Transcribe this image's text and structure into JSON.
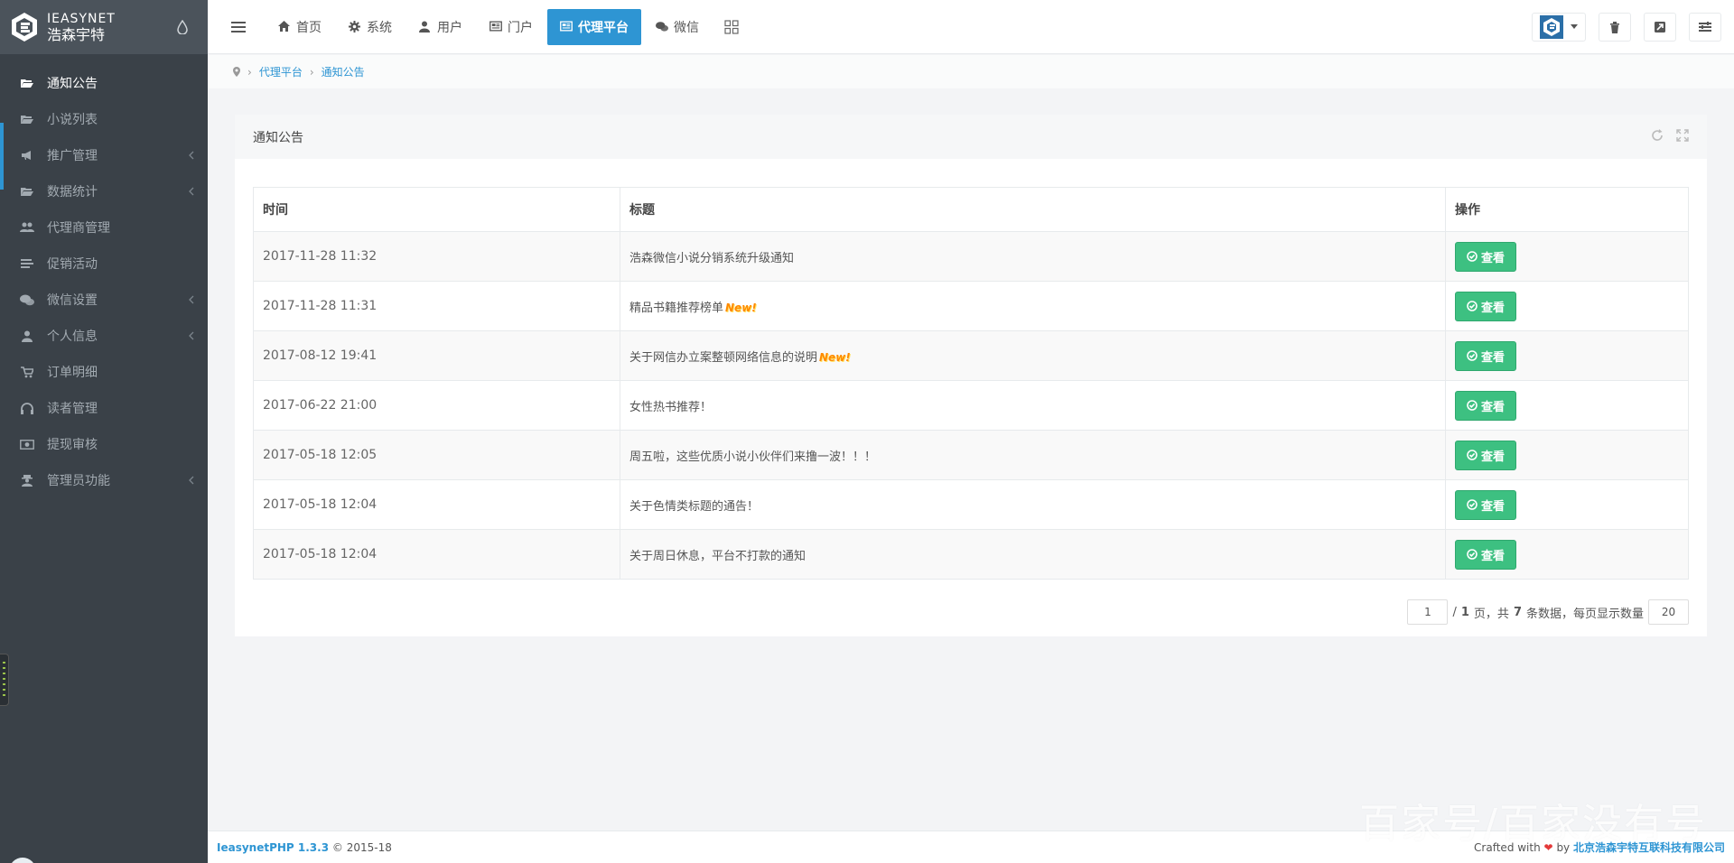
{
  "brand": {
    "en": "IEASYNET",
    "cn": "浩森宇特"
  },
  "sidebar": {
    "items": [
      {
        "label": "通知公告",
        "icon": "folder-open-icon",
        "active": true,
        "has_children": false
      },
      {
        "label": "小说列表",
        "icon": "folder-open-icon",
        "active": false,
        "has_children": false
      },
      {
        "label": "推广管理",
        "icon": "bullhorn-icon",
        "active": false,
        "has_children": true
      },
      {
        "label": "数据统计",
        "icon": "folder-open-icon",
        "active": false,
        "has_children": true
      },
      {
        "label": "代理商管理",
        "icon": "users-icon",
        "active": false,
        "has_children": false
      },
      {
        "label": "促销活动",
        "icon": "list-icon",
        "active": false,
        "has_children": false
      },
      {
        "label": "微信设置",
        "icon": "wechat-icon",
        "active": false,
        "has_children": true
      },
      {
        "label": "个人信息",
        "icon": "user-icon",
        "active": false,
        "has_children": true
      },
      {
        "label": "订单明细",
        "icon": "cart-icon",
        "active": false,
        "has_children": false
      },
      {
        "label": "读者管理",
        "icon": "headphones-icon",
        "active": false,
        "has_children": false
      },
      {
        "label": "提现审核",
        "icon": "money-icon",
        "active": false,
        "has_children": false
      },
      {
        "label": "管理员功能",
        "icon": "user-secret-icon",
        "active": false,
        "has_children": true
      }
    ]
  },
  "topnav": {
    "items": [
      {
        "label": "首页",
        "icon": "home-icon",
        "active": false
      },
      {
        "label": "系统",
        "icon": "gear-icon",
        "active": false
      },
      {
        "label": "用户",
        "icon": "user-icon",
        "active": false
      },
      {
        "label": "门户",
        "icon": "newspaper-icon",
        "active": false
      },
      {
        "label": "代理平台",
        "icon": "newspaper-icon",
        "active": true
      },
      {
        "label": "微信",
        "icon": "wechat-icon",
        "active": false
      }
    ]
  },
  "breadcrumb": {
    "level1": "代理平台",
    "level2": "通知公告"
  },
  "panel": {
    "title": "通知公告",
    "columns": {
      "time": "时间",
      "title": "标题",
      "action": "操作"
    },
    "view_label": "查看",
    "new_badge": "New!",
    "rows": [
      {
        "time": "2017-11-28 11:32",
        "title": "浩森微信小说分销系统升级通知",
        "is_new": false
      },
      {
        "time": "2017-11-28 11:31",
        "title": "精品书籍推荐榜单",
        "is_new": true
      },
      {
        "time": "2017-08-12 19:41",
        "title": "关于网信办立案整顿网络信息的说明",
        "is_new": true
      },
      {
        "time": "2017-06-22 21:00",
        "title": "女性热书推荐！",
        "is_new": false
      },
      {
        "time": "2017-05-18 12:05",
        "title": "周五啦，这些优质小说小伙伴们来撸一波！！！",
        "is_new": false
      },
      {
        "time": "2017-05-18 12:04",
        "title": "关于色情类标题的通告！",
        "is_new": false
      },
      {
        "time": "2017-05-18 12:04",
        "title": "关于周日休息，平台不打款的通知",
        "is_new": false
      }
    ]
  },
  "pager": {
    "current_page": "1",
    "sep": "/",
    "total_pages": "1",
    "page_unit": "页，共",
    "total_count": "7",
    "count_unit": "条数据，每页显示数量",
    "page_size": "20"
  },
  "footer": {
    "product": "IeasynetPHP 1.3.3",
    "copyright": "© 2015-18",
    "crafted": "Crafted with",
    "by": "by",
    "company": "北京浩森宇特互联科技有限公司"
  },
  "watermark": "百家号/百家没有号",
  "colors": {
    "primary": "#2e95d3",
    "success": "#3dc081",
    "sidebar": "#3a4148"
  }
}
